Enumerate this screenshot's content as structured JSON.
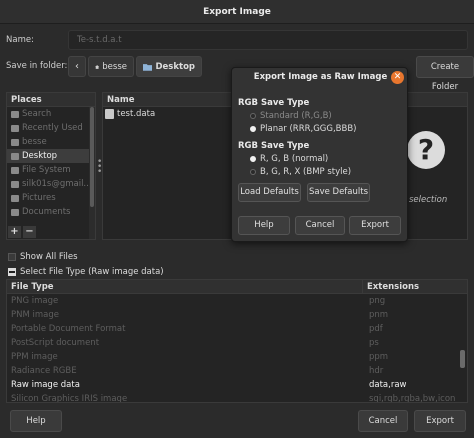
{
  "window": {
    "title": "Export Image"
  },
  "name_row": {
    "label": "Name:",
    "value": "Te-s.t.d.a.t"
  },
  "folder_row": {
    "label": "Save in folder:",
    "back_glyph": "‹",
    "crumbs": [
      "besse",
      "Desktop"
    ],
    "create_folder": "Create Folder"
  },
  "places": {
    "header": "Places",
    "items": [
      {
        "label": "Search",
        "icon": "search-icon",
        "dim": true
      },
      {
        "label": "Recently Used",
        "icon": "clock-icon",
        "dim": true
      },
      {
        "label": "besse",
        "icon": "home-icon",
        "dim": true
      },
      {
        "label": "Desktop",
        "icon": "folder-icon",
        "dim": false
      },
      {
        "label": "File System",
        "icon": "drive-icon",
        "dim": true
      },
      {
        "label": "silk01s@gmail...",
        "icon": "network-icon",
        "dim": true
      },
      {
        "label": "Pictures",
        "icon": "folder-icon",
        "dim": true
      },
      {
        "label": "Documents",
        "icon": "folder-icon",
        "dim": true
      }
    ],
    "add": "+",
    "remove": "−"
  },
  "files": {
    "header": "Name",
    "items": [
      "test.data"
    ],
    "preview_label": "selection"
  },
  "show_all_files": "Show All Files",
  "select_file_type": "Select File Type (Raw image data)",
  "filetypes": {
    "headers": [
      "File Type",
      "Extensions"
    ],
    "rows": [
      {
        "type": "PNG image",
        "ext": "png",
        "selected": false
      },
      {
        "type": "PNM image",
        "ext": "pnm",
        "selected": false
      },
      {
        "type": "Portable Document Format",
        "ext": "pdf",
        "selected": false
      },
      {
        "type": "PostScript document",
        "ext": "ps",
        "selected": false
      },
      {
        "type": "PPM image",
        "ext": "ppm",
        "selected": false
      },
      {
        "type": "Radiance RGBE",
        "ext": "hdr",
        "selected": false
      },
      {
        "type": "Raw image data",
        "ext": "data,raw",
        "selected": true
      },
      {
        "type": "Silicon Graphics IRIS image",
        "ext": "sgi,rgb,rgba,bw,icon",
        "selected": false
      }
    ]
  },
  "buttons": {
    "help": "Help",
    "cancel": "Cancel",
    "export": "Export"
  },
  "raw_dialog": {
    "title": "Export Image as Raw Image",
    "close": "✕",
    "save_type_title": "RGB Save Type",
    "save_type_options": [
      {
        "label": "Standard (R,G,B)",
        "checked": false
      },
      {
        "label": "Planar (RRR,GGG,BBB)",
        "checked": true
      }
    ],
    "save_type_title_2": "RGB Save Type",
    "order_options": [
      {
        "label": "R, G, B (normal)",
        "checked": true
      },
      {
        "label": "B, G, R, X (BMP style)",
        "checked": false
      }
    ],
    "load_defaults": "Load Defaults",
    "save_defaults": "Save Defaults",
    "help": "Help",
    "cancel": "Cancel",
    "export": "Export"
  },
  "colors": {
    "accent": "#e8762e",
    "bg": "#2b2b2b"
  }
}
